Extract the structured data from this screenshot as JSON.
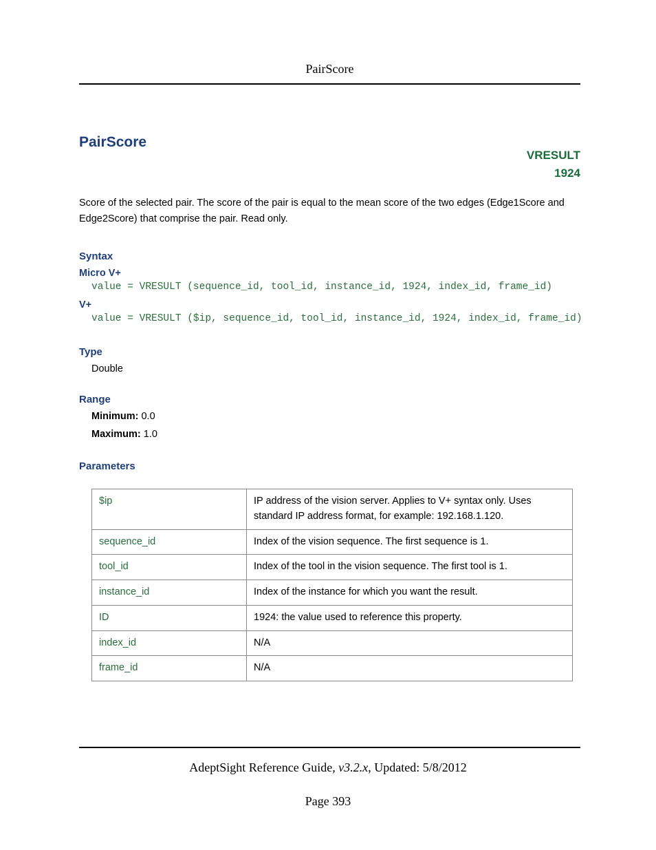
{
  "running_head": "PairScore",
  "title": "PairScore",
  "vresult_label": "VRESULT",
  "vresult_code": "1924",
  "intro": "Score of the selected pair. The score of the pair is equal to the mean score of the two edges (Edge1Score and Edge2Score) that comprise the pair. Read only.",
  "syntax": {
    "heading": "Syntax",
    "micro_label": "Micro V+",
    "micro_code": "value = VRESULT (sequence_id, tool_id, instance_id, 1924, index_id, frame_id)",
    "vplus_label": "V+",
    "vplus_code": "value = VRESULT ($ip, sequence_id, tool_id, instance_id, 1924, index_id, frame_id)"
  },
  "type": {
    "heading": "Type",
    "value": "Double"
  },
  "range": {
    "heading": "Range",
    "min_label": "Minimum:",
    "min_value": " 0.0",
    "max_label": "Maximum:",
    "max_value": " 1.0"
  },
  "parameters": {
    "heading": "Parameters",
    "rows": [
      {
        "name": "$ip",
        "desc": "IP address of the vision server. Applies to V+ syntax only. Uses standard IP address format, for example: 192.168.1.120."
      },
      {
        "name": "sequence_id",
        "desc": "Index of the vision sequence. The first sequence is 1."
      },
      {
        "name": "tool_id",
        "desc": "Index of the tool in the vision sequence. The first tool is 1."
      },
      {
        "name": "instance_id",
        "desc": "Index of the instance for which you want the result."
      },
      {
        "name": "ID",
        "desc": "1924: the value used to reference this property."
      },
      {
        "name": "index_id",
        "desc": "N/A"
      },
      {
        "name": "frame_id",
        "desc": "N/A"
      }
    ]
  },
  "footer": {
    "guide": "AdeptSight Reference Guide",
    "version": ", v3.2.x",
    "updated": ", Updated: 5/8/2012",
    "page": "Page 393"
  }
}
